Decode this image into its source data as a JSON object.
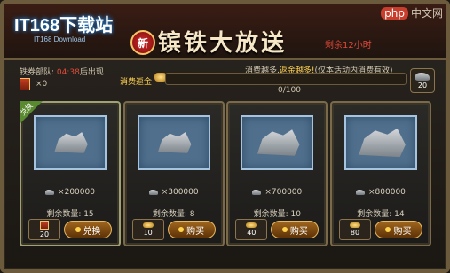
{
  "watermark": {
    "brand": "php",
    "text": "中文网"
  },
  "logo": {
    "text": "IT168下载站",
    "sub": "IT168 Download"
  },
  "header": {
    "badge": "新",
    "title": "镔铁大放送",
    "remaining": "剩余12小时"
  },
  "status": {
    "lineup_label": "铁券部队: ",
    "lineup_count": "04:38",
    "lineup_suffix": "后出现",
    "tokens": "×0"
  },
  "consume": {
    "tip_prefix": "消费越多,",
    "tip_highlight": "返金越多!",
    "tip_suffix": "(仅本活动内消费有效)",
    "bar_label": "消费返金",
    "progress_text": "0/100",
    "progress": 0,
    "reward_count": "20"
  },
  "cards": [
    {
      "corner": "兑换",
      "amount": "×200000",
      "remain": "剩余数量: 15",
      "price": "20",
      "button": "兑换"
    },
    {
      "corner": "",
      "amount": "×300000",
      "remain": "剩余数量: 8",
      "price": "10",
      "button": "购买"
    },
    {
      "corner": "",
      "amount": "×700000",
      "remain": "剩余数量: 10",
      "price": "40",
      "button": "购买"
    },
    {
      "corner": "",
      "amount": "×800000",
      "remain": "剩余数量: 14",
      "price": "80",
      "button": "购买"
    }
  ],
  "colors": {
    "accent": "#ffd24d",
    "alert": "#e04a3a",
    "frame": "#6b5a3c"
  }
}
